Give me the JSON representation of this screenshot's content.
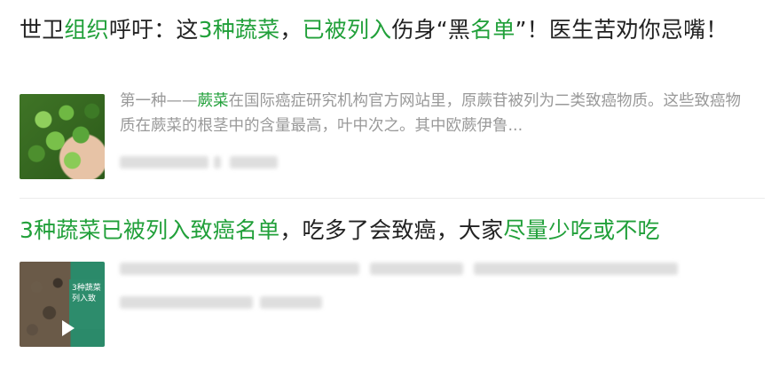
{
  "results": [
    {
      "title": {
        "segments": [
          {
            "text": "世卫",
            "hl": false
          },
          {
            "text": "组织",
            "hl": true
          },
          {
            "text": "呼吁：这",
            "hl": false
          },
          {
            "text": "3种蔬菜",
            "hl": true
          },
          {
            "text": "，",
            "hl": false
          },
          {
            "text": "已被列入",
            "hl": true
          },
          {
            "text": "伤身“黑",
            "hl": false
          },
          {
            "text": "名单",
            "hl": true
          },
          {
            "text": "”！医生苦劝你忌嘴！",
            "hl": false
          }
        ]
      },
      "description": {
        "segments": [
          {
            "text": "第一种——",
            "hl": false
          },
          {
            "text": "蕨菜",
            "hl": true
          },
          {
            "text": "在国际癌症研究机构官方网站里，原蕨苷被列为二类致癌物质。这些致癌物质在蕨菜的根茎中的含量最高，叶中次之。其中欧蕨伊鲁...",
            "hl": false
          }
        ]
      },
      "thumbnail": "green-fruit-in-hand-photo"
    },
    {
      "title": {
        "segments": [
          {
            "text": "3种蔬菜已被列入致癌名单",
            "hl": true
          },
          {
            "text": "，吃多了会致癌，大家",
            "hl": false
          },
          {
            "text": "尽量少吃或不吃",
            "hl": true
          }
        ]
      },
      "thumbnail": "dried-vegetable-video-thumbnail",
      "thumbnail_caption": "3种蔬菜列入致",
      "thumbnail_icon": "play-icon"
    }
  ],
  "colors": {
    "highlight": "#21a03a",
    "text": "#222222",
    "muted": "#999999",
    "divider": "#ececec"
  }
}
